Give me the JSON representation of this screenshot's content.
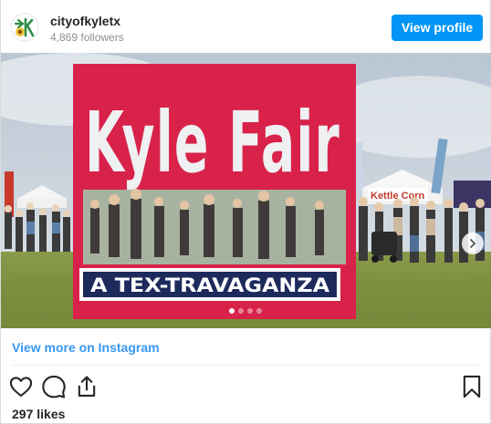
{
  "account": {
    "handle": "cityofkyletx",
    "followers": "4,869 followers",
    "view_profile_label": "View profile"
  },
  "photo": {
    "sign_title": "Kyle Fair",
    "sign_banner": "A TEX-TRAVAGANZA",
    "tent_banner": "Kettle Corn",
    "carousel": {
      "current": 1,
      "total": 4
    }
  },
  "footer": {
    "more_link": "View more on Instagram",
    "likes": "297 likes"
  },
  "colors": {
    "accent": "#0095f6",
    "link": "#3897f0",
    "sign_red": "#d8224a",
    "banner_navy": "#1d2a5c"
  },
  "icons": [
    "heart-icon",
    "comment-icon",
    "share-icon",
    "bookmark-icon",
    "chevron-right-icon"
  ]
}
